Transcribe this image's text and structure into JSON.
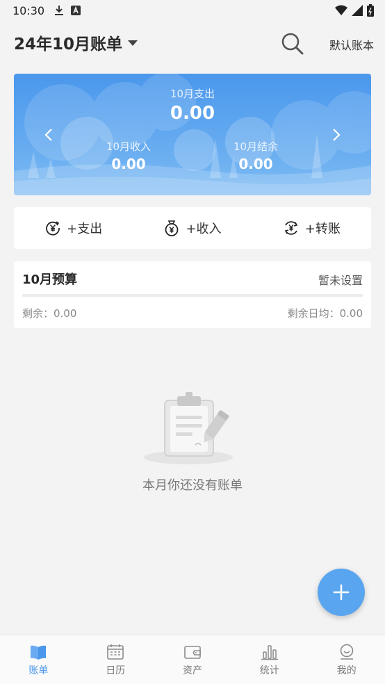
{
  "status": {
    "time": "10:30"
  },
  "header": {
    "month_title": "24年10月账单",
    "book_label": "默认账本"
  },
  "banner": {
    "expense_label": "10月支出",
    "expense_value": "0.00",
    "income_label": "10月收入",
    "income_value": "0.00",
    "balance_label": "10月结余",
    "balance_value": "0.00"
  },
  "quick": {
    "expense": "+支出",
    "income": "+收入",
    "transfer": "+转账"
  },
  "budget": {
    "title": "10月预算",
    "status": "暂未设置",
    "remaining": "剩余：0.00",
    "daily_avg": "剩余日均：0.00",
    "progress": 0
  },
  "empty": {
    "message": "本月你还没有账单"
  },
  "tabs": [
    {
      "label": "账单",
      "icon": "book-icon"
    },
    {
      "label": "日历",
      "icon": "calendar-icon"
    },
    {
      "label": "资产",
      "icon": "wallet-icon"
    },
    {
      "label": "统计",
      "icon": "chart-icon"
    },
    {
      "label": "我的",
      "icon": "profile-icon"
    }
  ],
  "colors": {
    "accent": "#4a97ec",
    "banner_top": "#4a97ec",
    "background": "#f3f3f3"
  }
}
